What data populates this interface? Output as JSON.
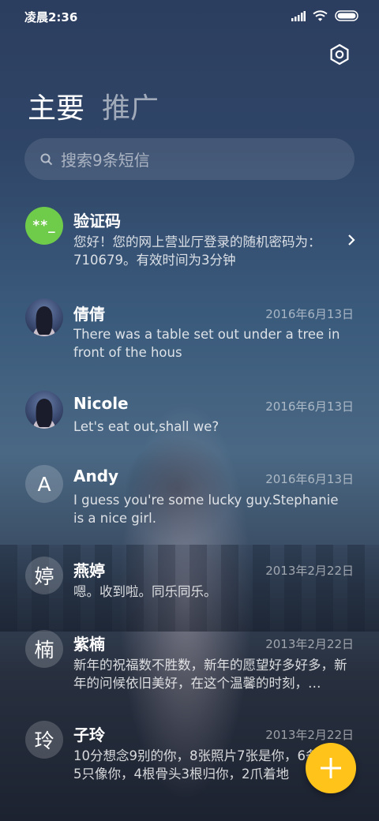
{
  "status_bar": {
    "time": "凌晨2:36"
  },
  "tabs": [
    {
      "label": "主要",
      "active": true
    },
    {
      "label": "推广",
      "active": false
    }
  ],
  "search": {
    "placeholder": "搜索9条短信"
  },
  "conversations": [
    {
      "name": "验证码",
      "avatar_type": "code",
      "avatar_text": "**_",
      "date": "",
      "preview": "您好！您的网上营业厅登录的随机密码为：710679。有效时间为3分钟",
      "has_chevron": true
    },
    {
      "name": "倩倩",
      "avatar_type": "photo",
      "avatar_text": "",
      "date": "2016年6月13日",
      "preview": "There was a table set out under a tree in front of the hous"
    },
    {
      "name": "Nicole",
      "avatar_type": "photo",
      "avatar_text": "",
      "date": "2016年6月13日",
      "preview": "Let's eat out,shall we?"
    },
    {
      "name": "Andy",
      "avatar_type": "letter",
      "avatar_text": "A",
      "date": "2016年6月13日",
      "preview": "I guess you're some lucky guy.Stephanie is a nice girl."
    },
    {
      "name": "燕婷",
      "avatar_type": "letter",
      "avatar_text": "婷",
      "date": "2013年2月22日",
      "preview": "嗯。收到啦。同乐同乐。"
    },
    {
      "name": "紫楠",
      "avatar_type": "letter",
      "avatar_text": "楠",
      "date": "2013年2月22日",
      "preview": "新年的祝福数不胜数，新年的愿望好多好多，新年的问候依旧美好，在这个温馨的时刻，…"
    },
    {
      "name": "子玲",
      "avatar_type": "letter",
      "avatar_text": "玲",
      "date": "2013年2月22日",
      "preview": "10分想念9别的你，8张照片7张是你，6条小狗5只像你，4根骨头3根归你，2爪着地"
    }
  ],
  "colors": {
    "fab": "#ffc31a",
    "code_avatar": "#6fcb4a"
  },
  "icons": {
    "settings": "settings-icon",
    "search": "search-icon",
    "fab": "plus-icon"
  }
}
